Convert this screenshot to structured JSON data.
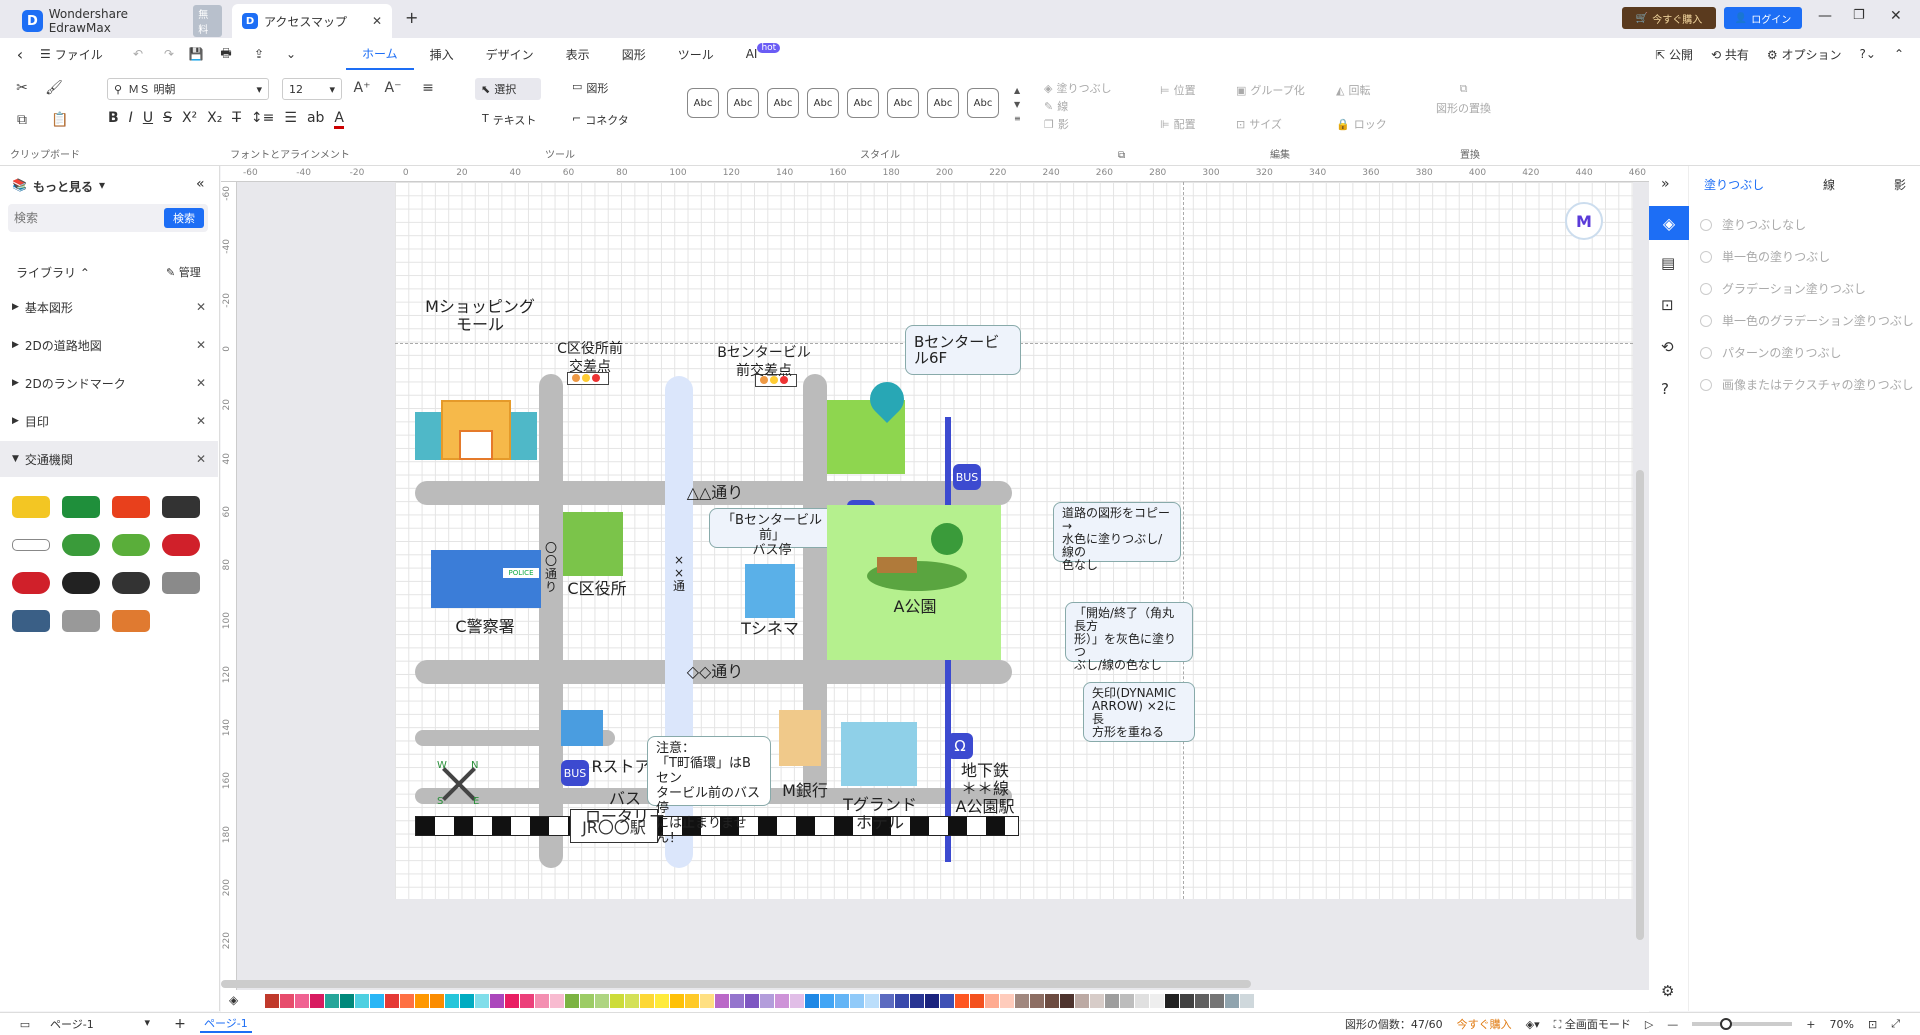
{
  "titlebar": {
    "app_tab": "Wondershare EdrawMax",
    "app_badge": "無料",
    "doc_tab": "アクセスマップ",
    "new_tab": "+",
    "buy_now": "今すぐ購入",
    "login": "ログイン"
  },
  "menu": {
    "file": "ファイル",
    "tabs": [
      "ホーム",
      "挿入",
      "デザイン",
      "表示",
      "図形",
      "ツール",
      "AI"
    ],
    "ai_badge": "hot",
    "publish": "公開",
    "share": "共有",
    "options": "オプション"
  },
  "ribbon": {
    "font_name": "ＭＳ 明朝",
    "font_size": "12",
    "groups": {
      "clipboard": "クリップボード",
      "font": "フォントとアラインメント",
      "tools": "ツール",
      "style": "スタイル",
      "edit": "編集",
      "replace": "置換"
    },
    "select": "選択",
    "shape": "図形",
    "text": "テキスト",
    "connector": "コネクタ",
    "abc_label": "Abc",
    "fill": "塗りつぶし",
    "line": "線",
    "shadow": "影",
    "position": "位置",
    "group": "グループ化",
    "rotate": "回転",
    "align": "配置",
    "size": "サイズ",
    "lock": "ロック",
    "replace_shape": "図形の置換"
  },
  "left": {
    "more": "もっと見る",
    "search_placeholder": "検索",
    "search_btn": "検索",
    "library": "ライブラリ",
    "manage": "管理",
    "items": [
      "基本図形",
      "2Dの道路地図",
      "2Dのランドマーク",
      "目印",
      "交通機関"
    ]
  },
  "map": {
    "mall": "Mショッピング\nモール",
    "ward_cross": "C区役所前\n交差点",
    "bcenter_cross": "Bセンタービル\n前交差点",
    "bcenter_6f": "Bセンタービル6F",
    "road_top": "△△通り",
    "road_mid": "◇◇通り",
    "bus_stop": "「Bセンタービル前」\nバス停",
    "ward_office": "C区役所",
    "police": "C警察署",
    "x_street": "×\n×\n通",
    "o_street": "〇\n〇\n通\nり",
    "cinema": "Tシネマ",
    "park": "A公園",
    "store": "Rストア",
    "bank": "M銀行",
    "hotel": "Tグランド\nホテル",
    "subway": "地下鉄\n＊＊線\nA公園駅",
    "bus_rotary": "バス\nロータリー",
    "jr_station": "JR〇〇駅",
    "note": "注意：\n「T町循環」はBセン\nタービル前のバス停\nには止まりません！",
    "police_sign": "POLICE",
    "bus_glyph": "BUS",
    "metro_glyph": "Ω",
    "compass": [
      "N",
      "E",
      "S",
      "W"
    ]
  },
  "notes": [
    "道路の図形をコピー→\n水色に塗りつぶし/線の\n色なし",
    "「開始/終了（角丸長方\n形）」を灰色に塗りつ\nぶし/線の色なし",
    "矢印(DYNAMIC\nARROW) ×2に長\n方形を重ねる"
  ],
  "right": {
    "tabs": [
      "塗りつぶし",
      "線",
      "影"
    ],
    "options": [
      "塗りつぶしなし",
      "単一色の塗りつぶし",
      "グラデーション塗りつぶし",
      "単一色のグラデーション塗りつぶし",
      "パターンの塗りつぶし",
      "画像またはテクスチャの塗りつぶし"
    ]
  },
  "status": {
    "page_sel": "ページ-1",
    "page_tab": "ページ-1",
    "shape_count": "図形の個数：47/60",
    "buy": "今すぐ購入",
    "fullscreen": "全画面モード",
    "zoom": "70%"
  },
  "ruler_h": [
    "-60",
    "-40",
    "-20",
    "0",
    "20",
    "40",
    "60",
    "80",
    "100",
    "120",
    "140",
    "160",
    "180",
    "200",
    "220",
    "240",
    "260",
    "280",
    "300",
    "320",
    "340",
    "360",
    "380",
    "400",
    "420",
    "440",
    "460"
  ],
  "ruler_v": [
    "-60",
    "-40",
    "-20",
    "0",
    "20",
    "40",
    "60",
    "80",
    "100",
    "120",
    "140",
    "160",
    "180",
    "200",
    "220"
  ],
  "palette": [
    "#c0392b",
    "#e74c6c",
    "#f06292",
    "#d81b60",
    "#26a69a",
    "#00897b",
    "#4dd0e1",
    "#29b6f6",
    "#e53935",
    "#ff7043",
    "#ff9800",
    "#fb8c00",
    "#26c6da",
    "#00acc1",
    "#80deea",
    "#ab47bc",
    "#e91e63",
    "#ec407a",
    "#f48fb1",
    "#f8bbd0",
    "#7cb342",
    "#9ccc65",
    "#aed581",
    "#cddc39",
    "#d4e157",
    "#fdd835",
    "#ffeb3b",
    "#ffc107",
    "#ffca28",
    "#ffe082",
    "#ba68c8",
    "#9575cd",
    "#7e57c2",
    "#b39ddb",
    "#ce93d8",
    "#e1bee7",
    "#1e88e5",
    "#42a5f5",
    "#64b5f6",
    "#90caf9",
    "#bbdefb",
    "#5c6bc0",
    "#3949ab",
    "#283593",
    "#1a237e",
    "#3f51b5",
    "#ff5722",
    "#f4511e",
    "#ffab91",
    "#ffccbc",
    "#a1887f",
    "#8d6e63",
    "#6d4c41",
    "#4e342e",
    "#bcaaa4",
    "#d7ccc8",
    "#9e9e9e",
    "#bdbdbd",
    "#e0e0e0",
    "#eeeeee",
    "#212121",
    "#424242",
    "#616161",
    "#757575",
    "#90a4ae",
    "#cfd8dc"
  ]
}
